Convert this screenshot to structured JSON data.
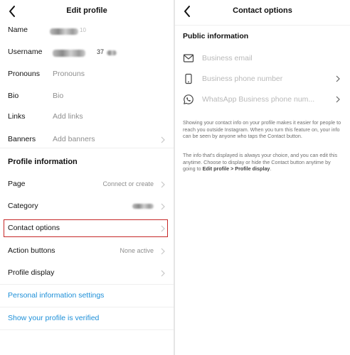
{
  "left": {
    "title": "Edit profile",
    "rows": [
      {
        "label": "Name",
        "value": "",
        "suffix": "10"
      },
      {
        "label": "Username",
        "value": "",
        "suffix": "37"
      },
      {
        "label": "Pronouns",
        "value": "Pronouns"
      },
      {
        "label": "Bio",
        "value": "Bio"
      },
      {
        "label": "Links",
        "value": "Add links"
      },
      {
        "label": "Banners",
        "value": "Add banners"
      }
    ],
    "section_title": "Profile information",
    "info_rows": [
      {
        "label": "Page",
        "value": "Connect or create"
      },
      {
        "label": "Category",
        "value": ""
      },
      {
        "label": "Contact options",
        "value": ""
      },
      {
        "label": "Action buttons",
        "value": "None active"
      },
      {
        "label": "Profile display",
        "value": ""
      }
    ],
    "links": [
      "Personal information settings",
      "Show your profile is verified"
    ]
  },
  "right": {
    "title": "Contact options",
    "section_title": "Public information",
    "options": [
      {
        "icon": "mail-icon",
        "placeholder": "Business email"
      },
      {
        "icon": "phone-icon",
        "placeholder": "Business phone number"
      },
      {
        "icon": "whatsapp-icon",
        "placeholder": "WhatsApp Business phone num..."
      }
    ],
    "paragraph1": "Showing your contact info on your profile makes it easier for people to reach you outside Instagram. When you turn this feature on, your info can be seen by anyone who taps the Contact button.",
    "paragraph2_start": "The info that's displayed is always your choice, and you can edit this anytime. Choose to display or hide the Contact button anytime by going to ",
    "paragraph2_bold": "Edit profile > Profile display",
    "paragraph2_end": "."
  },
  "colors": {
    "link": "#1d8fd8",
    "highlight": "#c62828",
    "muted": "#8e8e8e"
  }
}
